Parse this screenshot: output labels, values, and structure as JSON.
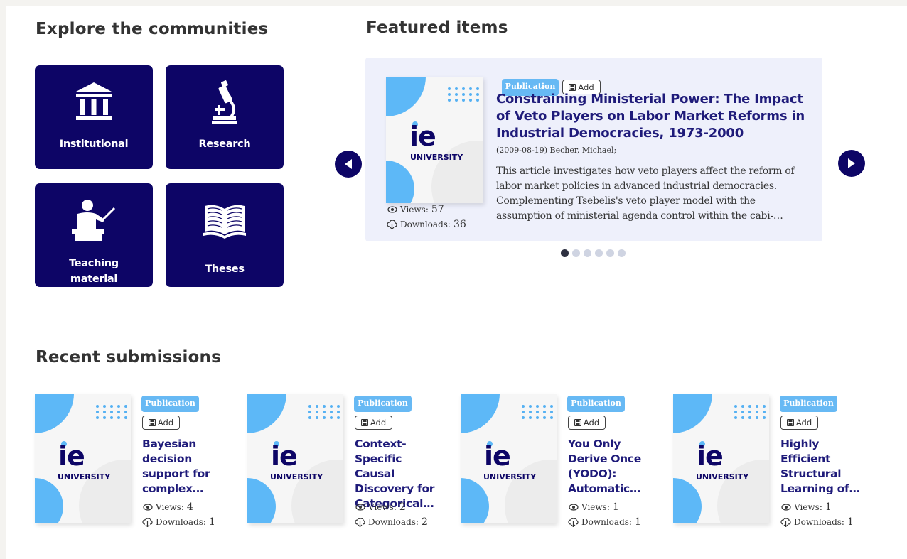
{
  "communities": {
    "title": "Explore the communities",
    "tiles": [
      {
        "label": "Institutional",
        "icon": "institution-icon"
      },
      {
        "label": "Research",
        "icon": "microscope-icon"
      },
      {
        "label": "Teaching material",
        "icon": "teacher-icon"
      },
      {
        "label": "Theses",
        "icon": "book-icon"
      }
    ]
  },
  "featured": {
    "title": "Featured items",
    "item": {
      "type_badge": "Publication",
      "add_label": "Add",
      "title": "Constraining Ministerial Power: The Impact of Veto Players on Labor Market Reforms in Industrial Democracies, 1973-2000",
      "meta": "(2009-08-19) Becher, Michael;",
      "abstract": "This article investigates how veto players affect the reform of labor market policies in advanced industrial democracies. Complementing Tsebelis's veto player model with the assumption of ministerial agenda control within the cabi-…",
      "views_label": "Views:",
      "views": "57",
      "downloads_label": "Downloads:",
      "downloads": "36"
    },
    "slide_count": 6,
    "active_slide": 1
  },
  "thumbnail": {
    "logo_text": "ie",
    "university_text": "UNIVERSITY"
  },
  "recent": {
    "title": "Recent submissions",
    "items": [
      {
        "type_badge": "Publication",
        "add_label": "Add",
        "title": "Bayesian decision support for complex…",
        "views_label": "Views:",
        "views": "4",
        "downloads_label": "Downloads:",
        "downloads": "1"
      },
      {
        "type_badge": "Publication",
        "add_label": "Add",
        "title": "Context-Specific Causal Discovery for Categorical…",
        "views_label": "Views:",
        "views": "2",
        "downloads_label": "Downloads:",
        "downloads": "2"
      },
      {
        "type_badge": "Publication",
        "add_label": "Add",
        "title": "You Only Derive Once (YODO): Automatic…",
        "views_label": "Views:",
        "views": "1",
        "downloads_label": "Downloads:",
        "downloads": "1"
      },
      {
        "type_badge": "Publication",
        "add_label": "Add",
        "title": "Highly Efficient Structural Learning of…",
        "views_label": "Views:",
        "views": "1",
        "downloads_label": "Downloads:",
        "downloads": "1"
      }
    ]
  },
  "colors": {
    "tile_bg": "#0d0566",
    "accent_blue": "#5db8f7",
    "title_color": "#1f1b7a",
    "featured_bg": "#eef0fb"
  }
}
